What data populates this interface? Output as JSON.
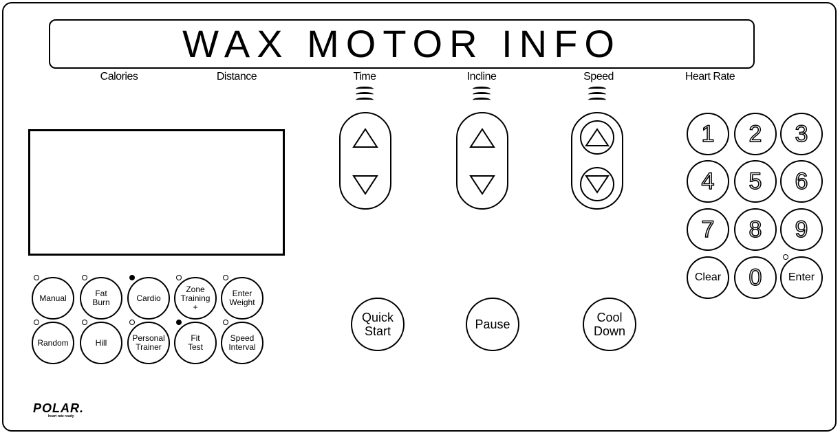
{
  "display": {
    "title": "WAX MOTOR INFO"
  },
  "labels": {
    "calories": "Calories",
    "distance": "Distance",
    "time": "Time",
    "incline": "Incline",
    "speed": "Speed",
    "heart_rate": "Heart Rate"
  },
  "programs": {
    "manual": "Manual",
    "fat_burn_1": "Fat",
    "fat_burn_2": "Burn",
    "cardio": "Cardio",
    "zone_training_1": "Zone",
    "zone_training_2": "Training",
    "zone_training_3": "+",
    "enter_weight_1": "Enter",
    "enter_weight_2": "Weight",
    "random": "Random",
    "hill": "Hill",
    "personal_trainer_1": "Personal",
    "personal_trainer_2": "Trainer",
    "fit_test_1": "Fit",
    "fit_test_2": "Test",
    "speed_interval_1": "Speed",
    "speed_interval_2": "Interval"
  },
  "leds": {
    "manual": false,
    "fat_burn": false,
    "cardio": true,
    "zone_training": false,
    "enter_weight": false,
    "random": false,
    "hill": false,
    "personal_trainer": false,
    "fit_test": true,
    "speed_interval": false,
    "enter": false
  },
  "controls": {
    "quick_start_1": "Quick",
    "quick_start_2": "Start",
    "pause": "Pause",
    "cool_down_1": "Cool",
    "cool_down_2": "Down"
  },
  "keypad": {
    "k1": "1",
    "k2": "2",
    "k3": "3",
    "k4": "4",
    "k5": "5",
    "k6": "6",
    "k7": "7",
    "k8": "8",
    "k9": "9",
    "clear": "Clear",
    "k0": "0",
    "enter": "Enter"
  },
  "brand": {
    "logo": "POLAR.",
    "tagline": "heart rate ready"
  },
  "icons": {
    "up": "triangle-up-icon",
    "down": "triangle-down-icon"
  }
}
